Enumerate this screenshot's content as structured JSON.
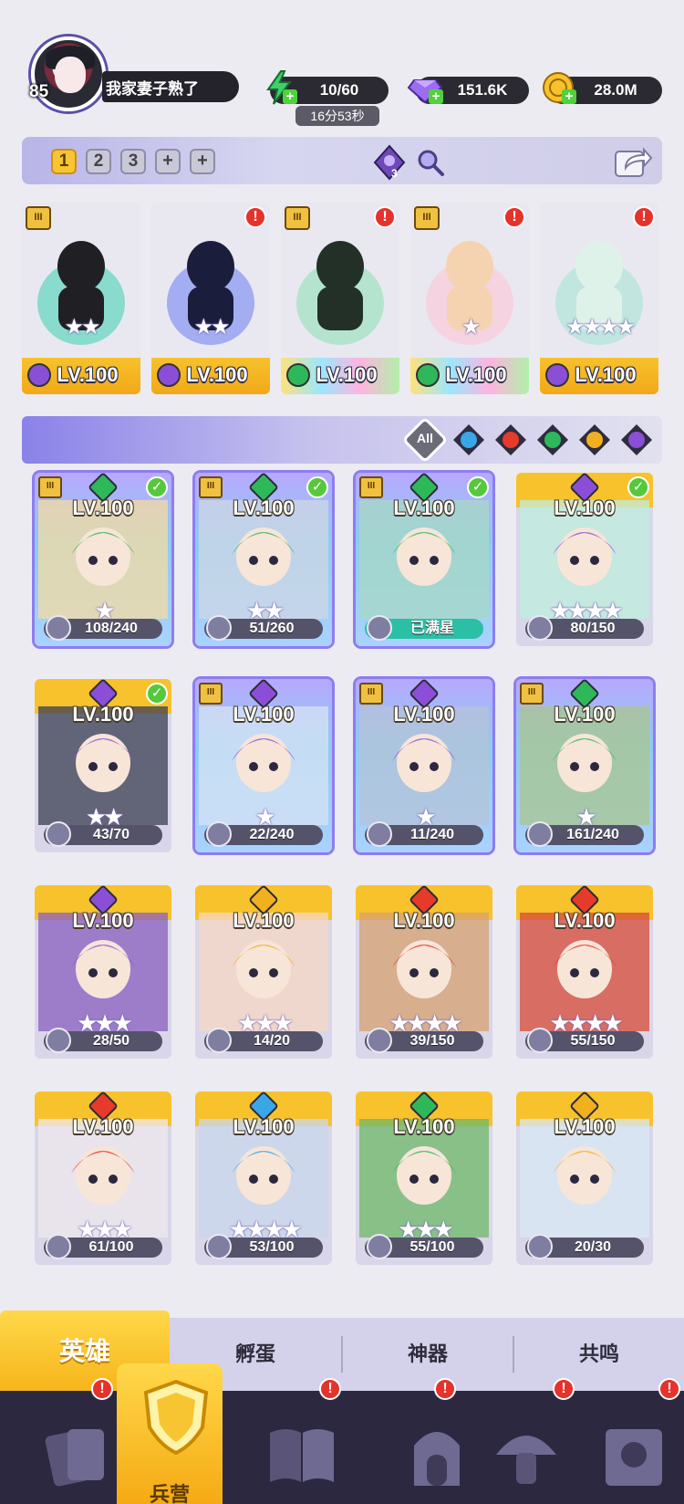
{
  "player": {
    "level": "85",
    "name": "我家妻子熟了"
  },
  "resources": {
    "energy": "10/60",
    "energy_timer": "16分53秒",
    "gems": "151.6K",
    "gold": "28.0M"
  },
  "teams": {
    "tabs": [
      "1",
      "2",
      "3"
    ],
    "add_tabs": [
      "+",
      "+"
    ],
    "badge_count": "3"
  },
  "lineup": [
    {
      "level": "LV.100",
      "element": "dark",
      "stars": "★★",
      "alert": false,
      "rank": true,
      "base": "gold"
    },
    {
      "level": "LV.100",
      "element": "dark",
      "stars": "★★",
      "alert": true,
      "rank": false,
      "base": "gold"
    },
    {
      "level": "LV.100",
      "element": "wind",
      "stars": "",
      "alert": true,
      "rank": true,
      "base": "rainbow"
    },
    {
      "level": "LV.100",
      "element": "wind",
      "stars": "★",
      "alert": true,
      "rank": true,
      "base": "rainbow"
    },
    {
      "level": "LV.100",
      "element": "dark",
      "stars": "★★★★",
      "alert": true,
      "rank": false,
      "base": "gold"
    }
  ],
  "filters": {
    "all_label": "All",
    "elements": [
      "water",
      "fire",
      "wind",
      "light",
      "dark"
    ]
  },
  "heroes": [
    {
      "level": "LV.100",
      "element": "wind",
      "shards": "108/240",
      "stars": "★",
      "check": true,
      "rank": true,
      "frame": "purple"
    },
    {
      "level": "LV.100",
      "element": "wind",
      "shards": "51/260",
      "stars": "★★",
      "check": true,
      "rank": true,
      "frame": "purple"
    },
    {
      "level": "LV.100",
      "element": "wind",
      "shards": "已满星",
      "stars": "",
      "check": true,
      "rank": true,
      "frame": "purple"
    },
    {
      "level": "LV.100",
      "element": "dark",
      "shards": "80/150",
      "stars": "★★★★",
      "check": true,
      "rank": false,
      "frame": "gold"
    },
    {
      "level": "LV.100",
      "element": "dark",
      "shards": "43/70",
      "stars": "★★",
      "check": true,
      "rank": false,
      "frame": "gold"
    },
    {
      "level": "LV.100",
      "element": "dark",
      "shards": "22/240",
      "stars": "★",
      "check": false,
      "rank": true,
      "frame": "purple"
    },
    {
      "level": "LV.100",
      "element": "dark",
      "shards": "11/240",
      "stars": "★",
      "check": false,
      "rank": true,
      "frame": "purple"
    },
    {
      "level": "LV.100",
      "element": "wind",
      "shards": "161/240",
      "stars": "★",
      "check": false,
      "rank": true,
      "frame": "purple"
    },
    {
      "level": "LV.100",
      "element": "dark",
      "shards": "28/50",
      "stars": "★★★",
      "check": false,
      "rank": false,
      "frame": "gold"
    },
    {
      "level": "LV.100",
      "element": "light",
      "shards": "14/20",
      "stars": "★★★",
      "check": false,
      "rank": false,
      "frame": "gold"
    },
    {
      "level": "LV.100",
      "element": "fire",
      "shards": "39/150",
      "stars": "★★★★",
      "check": false,
      "rank": false,
      "frame": "gold"
    },
    {
      "level": "LV.100",
      "element": "fire",
      "shards": "55/150",
      "stars": "★★★★",
      "check": false,
      "rank": false,
      "frame": "gold"
    },
    {
      "level": "LV.100",
      "element": "fire",
      "shards": "61/100",
      "stars": "★★★",
      "check": false,
      "rank": false,
      "frame": "gold"
    },
    {
      "level": "LV.100",
      "element": "water",
      "shards": "53/100",
      "stars": "★★★★",
      "check": false,
      "rank": false,
      "frame": "gold"
    },
    {
      "level": "LV.100",
      "element": "wind",
      "shards": "55/100",
      "stars": "★★★",
      "check": false,
      "rank": false,
      "frame": "gold"
    },
    {
      "level": "LV.100",
      "element": "light",
      "shards": "20/30",
      "stars": "",
      "check": false,
      "rank": false,
      "frame": "gold"
    }
  ],
  "sub_tabs": [
    "英雄",
    "孵蛋",
    "神器",
    "共鸣"
  ],
  "nav": {
    "active_label": "兵营",
    "alerts": [
      "!",
      "!",
      "!",
      "!",
      "!"
    ]
  },
  "colors": {
    "water": "#3aa6e8",
    "fire": "#e63a2a",
    "wind": "#2fb85a",
    "light": "#f0b020",
    "dark": "#8a4fd6",
    "gold_frame": "#f7c22c",
    "nav_bg": "#2b2840"
  }
}
